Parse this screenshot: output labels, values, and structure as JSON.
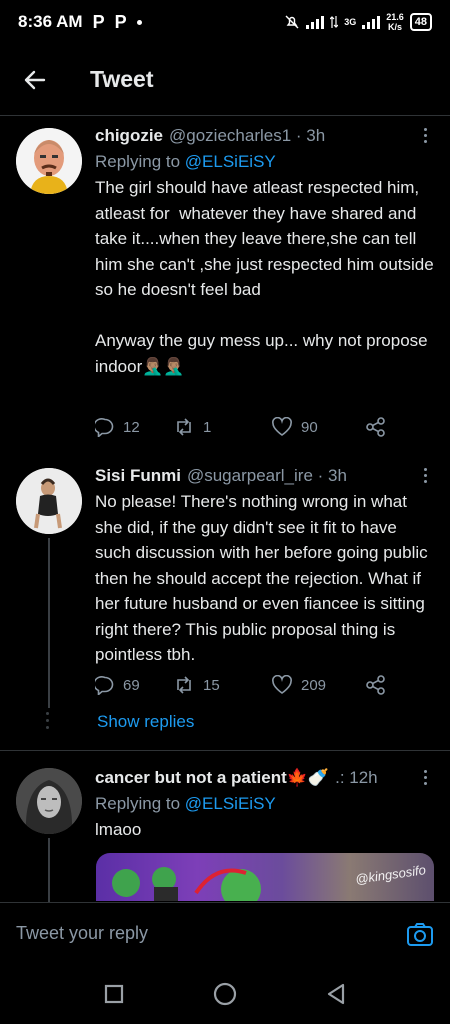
{
  "status_bar": {
    "time": "8:36 AM",
    "app_icons": [
      "P",
      "P"
    ],
    "network_type": "3G",
    "speed_value": "21.6",
    "speed_unit": "K/s",
    "battery": "48"
  },
  "header": {
    "title": "Tweet"
  },
  "tweets": [
    {
      "name": "chigozie",
      "handle": "@goziecharles1 · 3h",
      "replying_label": "Replying to",
      "replying_to": "@ELSiEiSY",
      "text": "The girl should have atleast respected him, atleast for  whatever they have shared and take it....when they leave there,she can tell him she can't ,she just respected him outside so he doesn't feel bad\n\nAnyway the guy mess up... why not propose indoor🤦🏽‍♂️🤦🏽‍♂️",
      "replies": "12",
      "retweets": "1",
      "likes": "90"
    },
    {
      "name": "Sisi Funmi",
      "handle": "@sugarpearl_ire · 3h",
      "text": "No please! There's nothing wrong in what she did, if the guy didn't see it fit to have such discussion with her before going public then he should accept the rejection. What if her future husband or even fiancee is sitting right there? This public proposal thing is pointless tbh.",
      "replies": "69",
      "retweets": "15",
      "likes": "209",
      "show_replies": "Show replies"
    },
    {
      "name": "cancer but not a patient🍁🍼",
      "handle": ".: 12h",
      "replying_label": "Replying to",
      "replying_to": "@ELSiEiSY",
      "text": "lmaoo",
      "media_watermark": "@kingsosifo"
    }
  ],
  "composer": {
    "placeholder": "Tweet your reply"
  },
  "icons": {
    "back": "arrow-left-icon",
    "more": "more-vertical-icon",
    "reply": "reply-icon",
    "retweet": "retweet-icon",
    "like": "heart-icon",
    "share": "share-icon",
    "camera": "camera-icon"
  },
  "colors": {
    "background": "#000000",
    "accent": "#1d9bf0",
    "secondary_text": "#8b98a5"
  }
}
